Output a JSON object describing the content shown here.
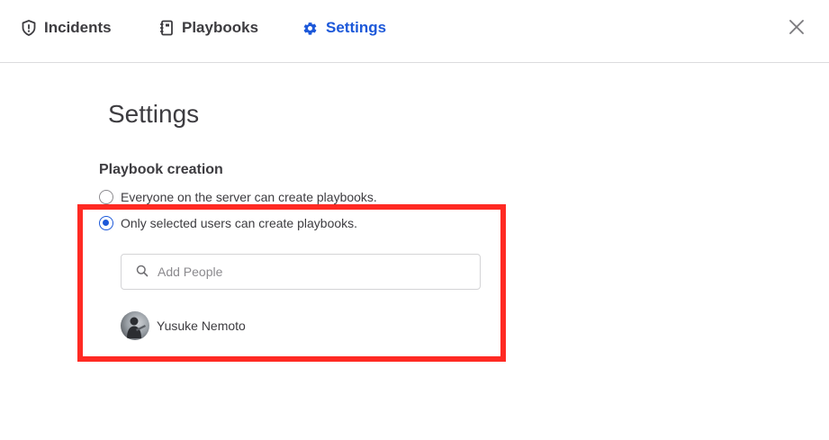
{
  "nav": {
    "tabs": [
      {
        "label": "Incidents",
        "icon": "shield-icon",
        "active": false
      },
      {
        "label": "Playbooks",
        "icon": "notebook-icon",
        "active": false
      },
      {
        "label": "Settings",
        "icon": "gear-icon",
        "active": true
      }
    ],
    "close_icon": "close-icon"
  },
  "page": {
    "title": "Settings"
  },
  "playbook_creation": {
    "title": "Playbook creation",
    "options": [
      {
        "label": "Everyone on the server can create playbooks.",
        "checked": false
      },
      {
        "label": "Only selected users can create playbooks.",
        "checked": true
      }
    ],
    "search": {
      "placeholder": "Add People",
      "icon": "search-icon"
    },
    "users": [
      {
        "name": "Yusuke Nemoto"
      }
    ]
  },
  "colors": {
    "accent": "#1c58d9",
    "text": "#3d3c40",
    "highlight": "#ff2a23",
    "divider": "#dcdcde"
  }
}
